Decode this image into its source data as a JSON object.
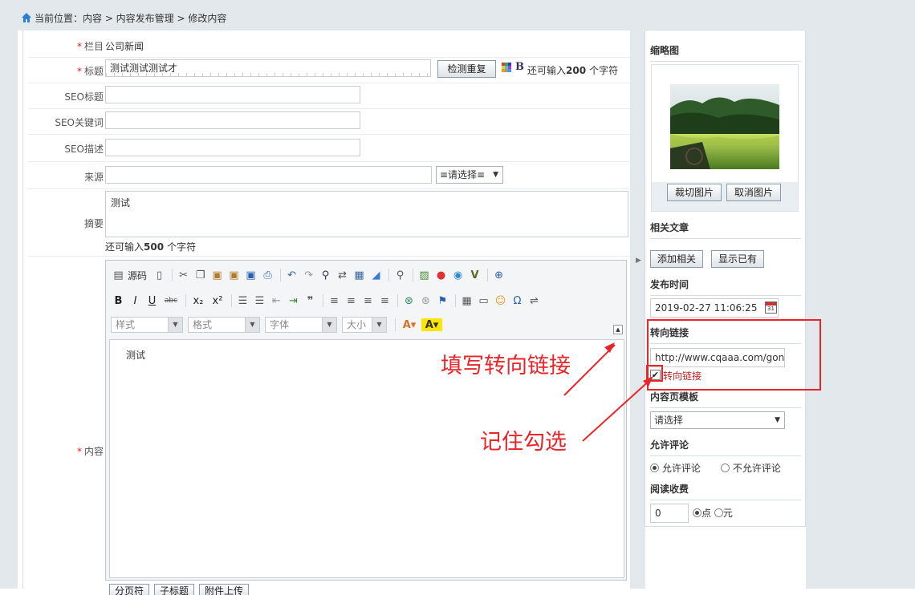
{
  "breadcrumb": "当前位置：内容 > 内容发布管理 > 修改内容",
  "form": {
    "category": {
      "label": "栏目",
      "value": "公司新闻"
    },
    "title": {
      "label": "标题",
      "value": "测试测试测试才",
      "check_button": "检测重复",
      "bold_glyph": "B",
      "hint_prefix": "还可输入",
      "hint_count": "200",
      "hint_suffix": "个字符"
    },
    "seo_title": {
      "label": "SEO标题",
      "value": ""
    },
    "seo_keywords": {
      "label": "SEO关键词",
      "value": ""
    },
    "seo_description": {
      "label": "SEO描述",
      "value": ""
    },
    "source": {
      "label": "来源",
      "value": "",
      "select": "≡请选择≡"
    },
    "summary": {
      "label": "摘要",
      "value": "测试",
      "hint_prefix": "还可输入",
      "hint_count": "500",
      "hint_suffix": "个字符"
    },
    "content": {
      "label": "内容",
      "value": "测试"
    }
  },
  "editor": {
    "source_label": "源码",
    "combos": [
      "样式",
      "格式",
      "字体",
      "大小"
    ],
    "bottom_buttons": [
      "分页符",
      "子标题",
      "附件上传"
    ]
  },
  "sidebar": {
    "thumbnail_title": "缩略图",
    "crop_button": "裁切图片",
    "cancel_image_button": "取消图片",
    "related_title": "相关文章",
    "add_related_button": "添加相关",
    "show_existing_button": "显示已有",
    "publish_time_title": "发布时间",
    "publish_time": "2019-02-27 11:06:25",
    "redirect_title": "转向链接",
    "redirect_url": "http://www.cqaaa.com/gongsixinwen/",
    "redirect_checkbox": "转向链接",
    "template_title": "内容页模板",
    "template_select": "请选择",
    "comments_title": "允许评论",
    "comments_allow": "允许评论",
    "comments_deny": "不允许评论",
    "fee_title": "阅读收费",
    "fee_value": "0",
    "fee_unit_points": "点",
    "fee_unit_yuan": "元"
  },
  "annotations": {
    "fill_redirect": "填写转向链接",
    "remember_check": "记住勾选"
  },
  "colors": {
    "annotation": "#e8262a",
    "required": "#e02020",
    "background": "#e2e8ec"
  }
}
